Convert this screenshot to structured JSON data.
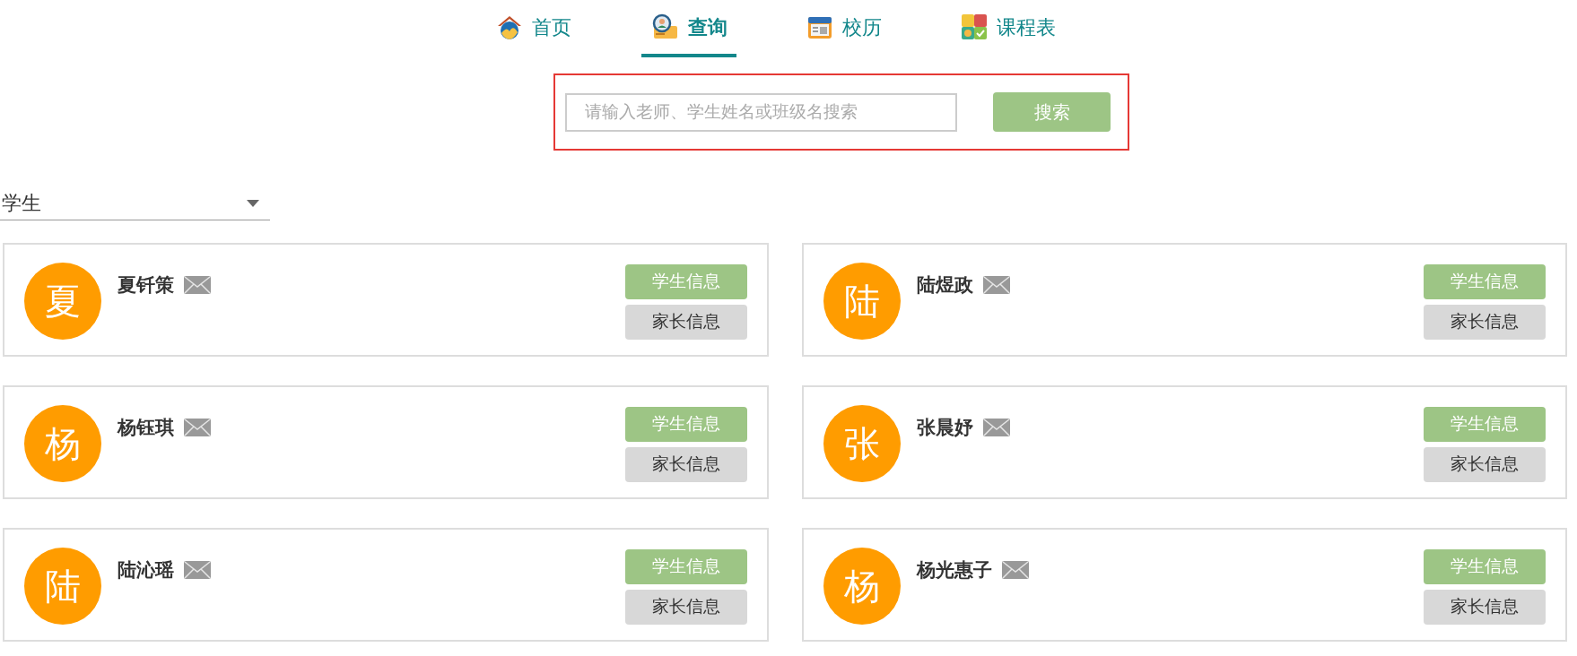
{
  "nav": [
    {
      "kind": "home",
      "label": "首页",
      "selected": false
    },
    {
      "kind": "query",
      "label": "查询",
      "selected": true
    },
    {
      "kind": "calendar",
      "label": "校历",
      "selected": false
    },
    {
      "kind": "timetable",
      "label": "课程表",
      "selected": false
    }
  ],
  "search": {
    "placeholder": "请输入老师、学生姓名或班级名搜索",
    "button": "搜索"
  },
  "filter": {
    "value": "学生"
  },
  "students": [
    {
      "avatar": "夏",
      "name": "夏钎策",
      "student_button": "学生信息",
      "parent_button": "家长信息"
    },
    {
      "avatar": "陆",
      "name": "陆煜政",
      "student_button": "学生信息",
      "parent_button": "家长信息"
    },
    {
      "avatar": "杨",
      "name": "杨钰琪",
      "student_button": "学生信息",
      "parent_button": "家长信息"
    },
    {
      "avatar": "张",
      "name": "张晨妤",
      "student_button": "学生信息",
      "parent_button": "家长信息"
    },
    {
      "avatar": "陆",
      "name": "陆沁瑶",
      "student_button": "学生信息",
      "parent_button": "家长信息"
    },
    {
      "avatar": "杨",
      "name": "杨光惠子",
      "student_button": "学生信息",
      "parent_button": "家长信息"
    }
  ]
}
